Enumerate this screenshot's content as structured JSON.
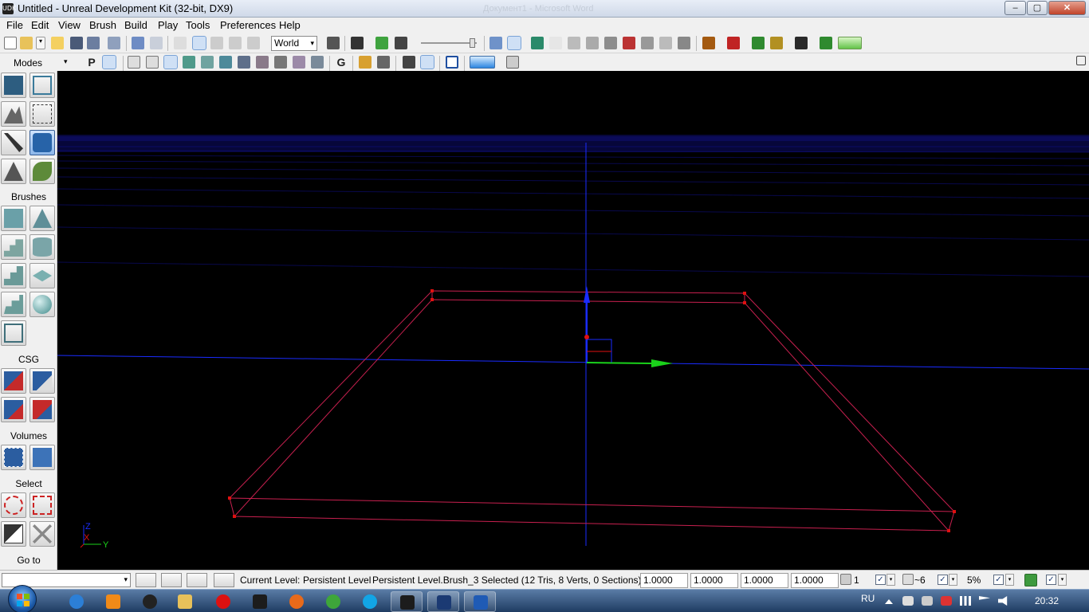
{
  "window": {
    "title": "Untitled - Unreal Development Kit (32-bit, DX9)",
    "background_title": "Документ1 - Microsoft Word",
    "minimize_label": "–",
    "maximize_label": "▢",
    "close_label": "✕",
    "app_icon_text": "UDK"
  },
  "menubar": {
    "items": [
      "File",
      "Edit",
      "View",
      "Brush",
      "Build",
      "Play",
      "Tools",
      "Preferences",
      "Help"
    ]
  },
  "main_toolbar": {
    "coordinate_system": "World",
    "coordinate_dropdown_arrow": "▾"
  },
  "modes_panel": {
    "header": "Modes",
    "header_arrow": "▾",
    "sections": {
      "modes": "Modes",
      "brushes": "Brushes",
      "csg": "CSG",
      "volumes": "Volumes",
      "select": "Select",
      "goto": "Go to"
    }
  },
  "viewport_toolbar": {
    "letter_p": "P",
    "letter_g": "G"
  },
  "viewport": {
    "axis_labels": {
      "z": "Z",
      "x": "X",
      "y": "Y"
    },
    "colors": {
      "grid": "#10108a",
      "brush": "#c8204f",
      "vertex": "#e01010",
      "axis_z": "#1a2cff",
      "axis_y": "#1ad21a",
      "axis_x": "#e01010"
    }
  },
  "statusbar": {
    "current_level_label": "Current Level:",
    "current_level_value": "Persistent Level",
    "selection_info": "Persistent Level.Brush_3 Selected (12 Tris, 8 Verts, 0 Sections)",
    "drag_grid_values": [
      "1.0000",
      "1.0000",
      "1.0000",
      "1.0000"
    ],
    "grid_size": "1",
    "rotation_snap": "~6",
    "scale_snap": "5%",
    "check_mark": "✓",
    "dropdown_arrow": "▾"
  },
  "taskbar": {
    "language": "RU",
    "clock": "20:32"
  }
}
